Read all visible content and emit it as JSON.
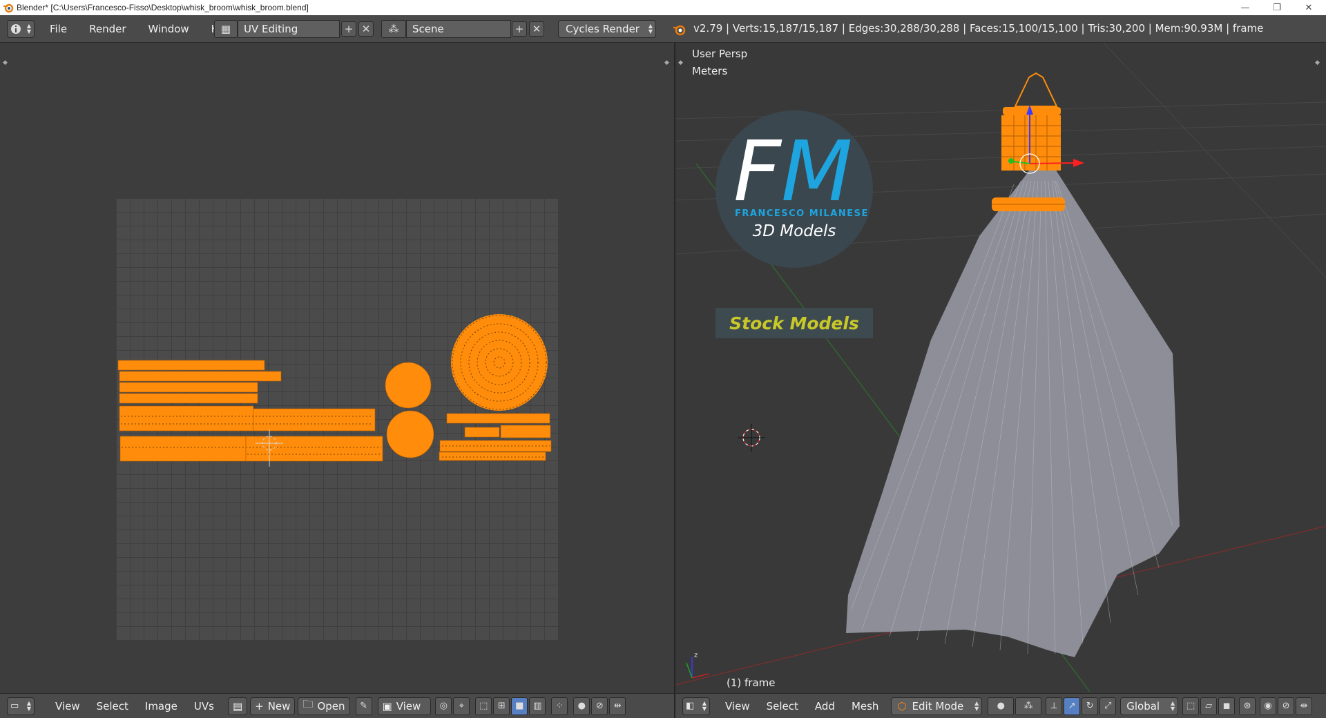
{
  "window": {
    "title": "Blender* [C:\\Users\\Francesco-Fisso\\Desktop\\whisk_broom\\whisk_broom.blend]",
    "minimize_glyph": "—",
    "restore_glyph": "❐",
    "close_glyph": "✕"
  },
  "info_header": {
    "menus": [
      "File",
      "Render",
      "Window",
      "Help"
    ],
    "screen_layout": "UV Editing",
    "scene": "Scene",
    "render_engine": "Cycles Render",
    "stats": "v2.79 | Verts:15,187/15,187 | Edges:30,288/30,288 | Faces:15,100/15,100 | Tris:30,200 | Mem:90.93M | frame"
  },
  "viewport": {
    "view_name": "User Persp",
    "units": "Meters",
    "object_label": "(1) frame"
  },
  "logo": {
    "letter_f": "F",
    "letter_m": "M",
    "name": "FRANCESCO MILANESE",
    "subtitle": "3D Models",
    "tagline": "Stock Models"
  },
  "uv_footer": {
    "menus": [
      "View",
      "Select",
      "Image",
      "UVs"
    ],
    "new_label": "New",
    "open_label": "Open",
    "view_label": "View"
  },
  "view3d_footer": {
    "menus": [
      "View",
      "Select",
      "Add",
      "Mesh"
    ],
    "mode": "Edit Mode",
    "orientation": "Global"
  },
  "colors": {
    "selection_orange": "#ff8c0a",
    "logo_blue": "#1ea5df",
    "logo_yellow": "#c8c828",
    "mesh_grey": "#a9a9b2"
  }
}
